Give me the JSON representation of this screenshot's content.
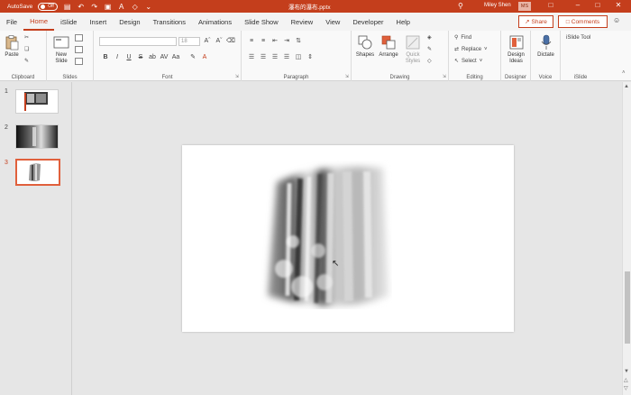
{
  "titlebar": {
    "autosave_label": "AutoSave",
    "autosave_state": "Off",
    "doc_title": "瀑布的瀑布.pptx",
    "user_name": "Miley Shen",
    "user_initials": "MS"
  },
  "menu": {
    "tabs": [
      "File",
      "Home",
      "iSlide",
      "Insert",
      "Design",
      "Transitions",
      "Animations",
      "Slide Show",
      "Review",
      "View",
      "Developer",
      "Help"
    ],
    "active_tab": "Home",
    "share_label": "Share",
    "comments_label": "Comments"
  },
  "ribbon": {
    "clipboard": {
      "paste_label": "Paste",
      "group_label": "Clipboard"
    },
    "slides": {
      "new_slide_label": "New Slide",
      "group_label": "Slides"
    },
    "font": {
      "font_name": "",
      "font_size": "18",
      "group_label": "Font",
      "bold": "B",
      "italic": "I",
      "underline": "U",
      "strike": "S",
      "shadow": "ab",
      "spacing": "AV",
      "case": "Aa"
    },
    "paragraph": {
      "group_label": "Paragraph"
    },
    "drawing": {
      "shapes_label": "Shapes",
      "arrange_label": "Arrange",
      "quick_styles_label": "Quick Styles",
      "group_label": "Drawing"
    },
    "editing": {
      "find_label": "Find",
      "replace_label": "Replace",
      "select_label": "Select",
      "group_label": "Editing"
    },
    "designer": {
      "design_ideas_label": "Design Ideas",
      "group_label": "Designer"
    },
    "voice": {
      "dictate_label": "Dictate",
      "group_label": "Voice"
    },
    "islide": {
      "tool_label": "iSlide Tool",
      "group_label": "iSlide"
    }
  },
  "thumbnails": [
    {
      "number": "1"
    },
    {
      "number": "2"
    },
    {
      "number": "3"
    }
  ],
  "selected_slide": "3",
  "colors": {
    "accent": "#c43e1c",
    "titlebar": "#c43e1c",
    "canvas_bg": "#e6e6e6"
  }
}
